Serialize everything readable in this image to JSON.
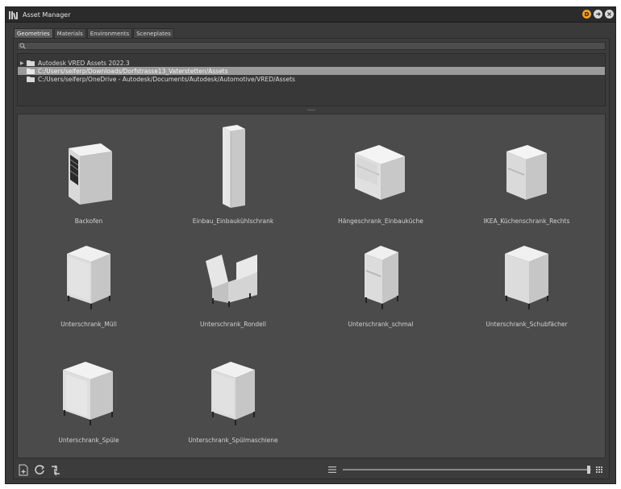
{
  "window": {
    "title": "Asset Manager"
  },
  "tabs": [
    {
      "label": "Geometries",
      "active": true
    },
    {
      "label": "Materials",
      "active": false
    },
    {
      "label": "Environments",
      "active": false
    },
    {
      "label": "Sceneplates",
      "active": false
    }
  ],
  "search": {
    "placeholder": "",
    "value": ""
  },
  "tree": [
    {
      "label": "Autodesk VRED Assets 2022.3",
      "expandable": true,
      "selected": false
    },
    {
      "label": "C:/Users/seiferp/Downloads/Dorfstrasse13_Vaterstetten/Assets",
      "expandable": false,
      "selected": true
    },
    {
      "label": "C:/Users/seiferp/OneDrive - Autodesk/Documents/Autodesk/Automotive/VRED/Assets",
      "expandable": false,
      "selected": false
    }
  ],
  "assets": [
    {
      "label": "Backofen",
      "shape": "oven"
    },
    {
      "label": "Einbau_Einbaukühlschrank",
      "shape": "tall"
    },
    {
      "label": "Hängeschrank_Einbauküche",
      "shape": "hanging"
    },
    {
      "label": "IKEA_Küchenschrank_Rechts",
      "shape": "hanging-right"
    },
    {
      "label": "Unterschrank_Müll",
      "shape": "base"
    },
    {
      "label": "Unterschrank_Rondell",
      "shape": "corner"
    },
    {
      "label": "Unterschrank_schmal",
      "shape": "narrow"
    },
    {
      "label": "Unterschrank_Schubfächer",
      "shape": "base"
    },
    {
      "label": "Unterschrank_Spüle",
      "shape": "sink"
    },
    {
      "label": "Unterschrank_Spülmaschiene",
      "shape": "base"
    }
  ],
  "thumbnail_size": {
    "fraction": 0.99
  },
  "colors": {
    "panel": "#3a3a3a",
    "grid": "#4b4b4b",
    "selected_row": "#9a9a9a",
    "accent_badge": "#f0a020"
  }
}
